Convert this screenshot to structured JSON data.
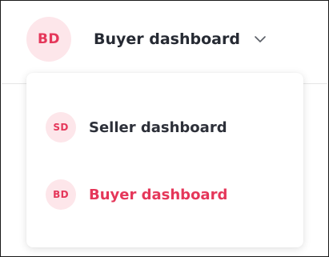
{
  "switcher": {
    "current_initials": "BD",
    "current_label": "Buyer dashboard",
    "chevron_icon": "chevron-down-icon"
  },
  "menu": {
    "items": [
      {
        "initials": "SD",
        "label": "Seller dashboard",
        "active": false
      },
      {
        "initials": "BD",
        "label": "Buyer dashboard",
        "active": true
      }
    ]
  },
  "colors": {
    "accent": "#e5375a",
    "avatar_bg": "#fde6ea",
    "text": "#262a33"
  }
}
